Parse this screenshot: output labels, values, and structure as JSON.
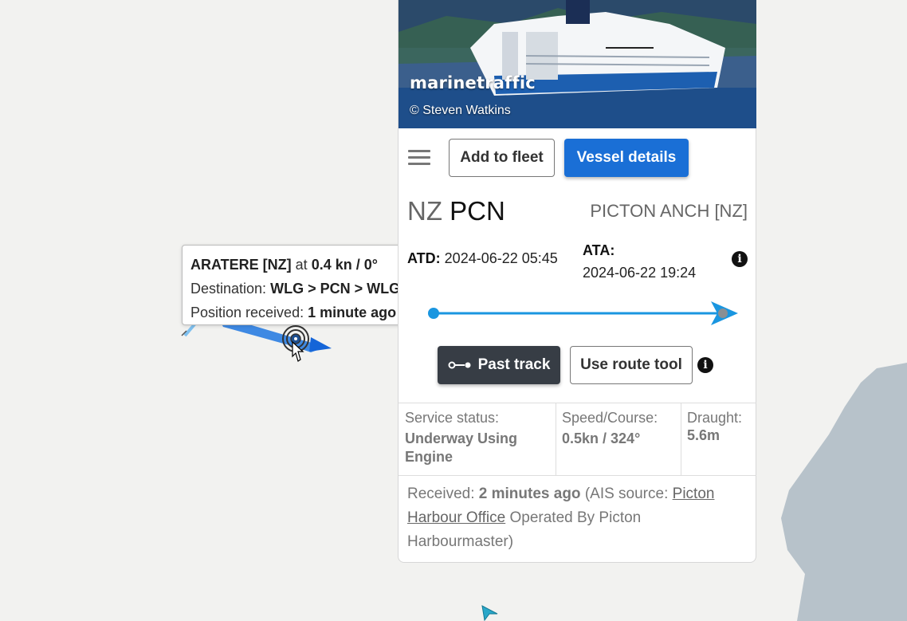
{
  "tooltip": {
    "vessel_name": "ARATERE [NZ]",
    "at_text": "at",
    "speed_heading": "0.4 kn / 0°",
    "destination_label": "Destination:",
    "destination_value": "WLG > PCN > WLG",
    "position_label": "Position received:",
    "position_value": "1 minute ago"
  },
  "photo": {
    "brand": "marinetraffic",
    "credit": "© Steven Watkins"
  },
  "actions": {
    "menu_icon": "hamburger-menu-icon",
    "add_to_fleet": "Add to fleet",
    "vessel_details": "Vessel details"
  },
  "voyage": {
    "from_country": "NZ",
    "from_port": "PCN",
    "to_port": "PICTON ANCH [NZ]",
    "atd_label": "ATD:",
    "atd_value": "2024-06-22 05:45",
    "ata_label": "ATA:",
    "ata_value": "2024-06-22 19:24",
    "progress_fraction": 1.0
  },
  "track": {
    "past_track": "Past track",
    "use_route_tool": "Use route tool"
  },
  "status": {
    "service_label": "Service status:",
    "service_value": "Underway Using Engine",
    "speed_label": "Speed/Course:",
    "speed_value": "0.5kn / 324°",
    "draught_label": "Draught:",
    "draught_value": "5.6m"
  },
  "received": {
    "label": "Received:",
    "value": "2 minutes ago",
    "ais_prefix": "(AIS source:",
    "ais_link": "Picton Harbour Office",
    "operated_by": "Operated By Picton Harbourmaster)"
  },
  "colors": {
    "primary": "#1a6fd6",
    "dark_button": "#373d45",
    "track": "#1a96e0",
    "land": "#b7c2ca"
  }
}
